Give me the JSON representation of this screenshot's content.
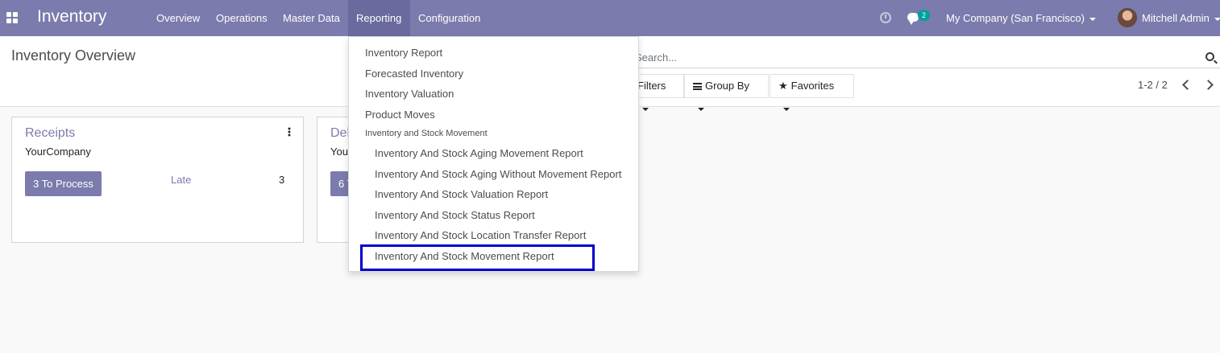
{
  "navbar": {
    "app_title": "Inventory",
    "menu": [
      "Overview",
      "Operations",
      "Master Data",
      "Reporting",
      "Configuration"
    ],
    "active_menu": "Reporting",
    "chat_count": "2",
    "company": "My Company (San Francisco)",
    "user": "Mitchell Admin",
    "colors": {
      "bar": "#7c7bad",
      "active_item": "#6a6a9e",
      "badge": "#00a09d"
    }
  },
  "control_panel": {
    "title": "Inventory Overview",
    "search_placeholder": "Search...",
    "filters_label": "Filters",
    "group_by_label": "Group By",
    "favorites_label": "Favorites",
    "pager": "1-2 / 2"
  },
  "cards": [
    {
      "title": "Receipts",
      "company": "YourCompany",
      "process_label": "3 To Process",
      "late_label": "Late",
      "late_count": "3"
    },
    {
      "title": "Delivery Orders",
      "company": "YourCompany",
      "process_label": "6 To Process"
    }
  ],
  "dropdown": {
    "items": [
      "Inventory Report",
      "Forecasted Inventory",
      "Inventory Valuation",
      "Product Moves"
    ],
    "section_header": "Inventory and Stock Movement",
    "sub_items": [
      "Inventory And Stock Aging Movement Report",
      "Inventory And Stock Aging Without Movement Report",
      "Inventory And Stock Valuation Report",
      "Inventory And Stock Status Report",
      "Inventory And Stock Location Transfer Report",
      "Inventory And Stock Movement Report"
    ],
    "highlight_color": "#0000c8"
  }
}
